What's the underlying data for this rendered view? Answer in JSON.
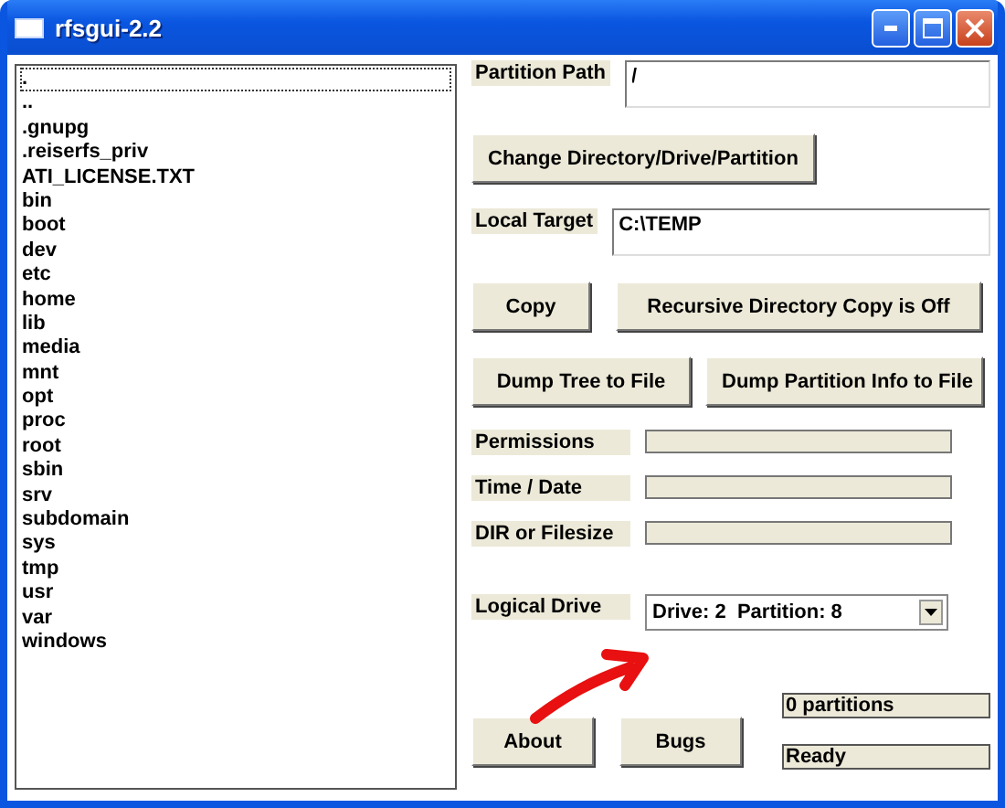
{
  "window": {
    "title": "rfsgui-2.2"
  },
  "file_list": [
    {
      "name": ".",
      "selected": true
    },
    {
      "name": "..",
      "selected": false
    },
    {
      "name": ".gnupg",
      "selected": false
    },
    {
      "name": ".reiserfs_priv",
      "selected": false
    },
    {
      "name": "ATI_LICENSE.TXT",
      "selected": false
    },
    {
      "name": "bin",
      "selected": false
    },
    {
      "name": "boot",
      "selected": false
    },
    {
      "name": "dev",
      "selected": false
    },
    {
      "name": "etc",
      "selected": false
    },
    {
      "name": "home",
      "selected": false
    },
    {
      "name": "lib",
      "selected": false
    },
    {
      "name": "media",
      "selected": false
    },
    {
      "name": "mnt",
      "selected": false
    },
    {
      "name": "opt",
      "selected": false
    },
    {
      "name": "proc",
      "selected": false
    },
    {
      "name": "root",
      "selected": false
    },
    {
      "name": "sbin",
      "selected": false
    },
    {
      "name": "srv",
      "selected": false
    },
    {
      "name": "subdomain",
      "selected": false
    },
    {
      "name": "sys",
      "selected": false
    },
    {
      "name": "tmp",
      "selected": false
    },
    {
      "name": "usr",
      "selected": false
    },
    {
      "name": "var",
      "selected": false
    },
    {
      "name": "windows",
      "selected": false
    }
  ],
  "partition_path": {
    "label": "Partition Path",
    "value": "/"
  },
  "change_button": "Change Directory/Drive/Partition",
  "local_target": {
    "label": "Local Target",
    "value": "C:\\TEMP"
  },
  "copy_buttons": [
    "Copy",
    "Recursive Directory Copy is Off"
  ],
  "dump_buttons": [
    "Dump Tree to File",
    "Dump Partition Info to File"
  ],
  "info_fields": [
    {
      "label": "Permissions"
    },
    {
      "label": "Time / Date"
    },
    {
      "label": "DIR or Filesize"
    }
  ],
  "logical_drive": {
    "label": "Logical Drive",
    "value": "Drive: 2  Partition: 8"
  },
  "bottom_buttons": [
    "About",
    "Bugs"
  ],
  "status": [
    "0 partitions",
    "Ready"
  ]
}
